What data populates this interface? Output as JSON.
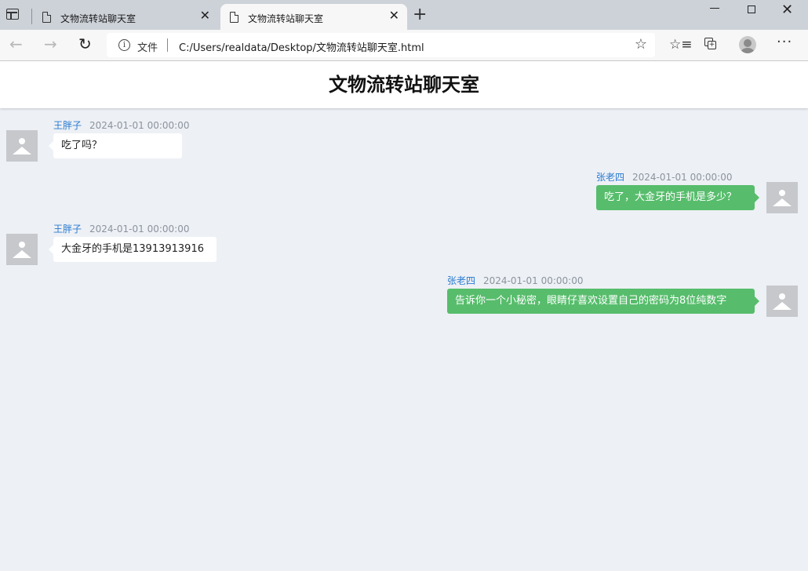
{
  "browser": {
    "tabs": [
      {
        "title": "文物流转站聊天室",
        "close": "✕"
      },
      {
        "title": "文物流转站聊天室",
        "close": "✕"
      }
    ],
    "new_tab": "+",
    "address": {
      "info": "i",
      "file_label": "文件",
      "url": "C:/Users/realdata/Desktop/文物流转站聊天室.html"
    },
    "icons": {
      "back": "back-arrow-icon",
      "forward": "forward-arrow-icon",
      "reload": "reload-icon",
      "favorites": "favorites-icon",
      "collections": "collections-icon",
      "profile": "profile-icon",
      "more": "more-icon"
    }
  },
  "page": {
    "title": "文物流转站聊天室"
  },
  "messages": [
    {
      "side": "left",
      "name": "王胖子",
      "time": "2024-01-01 00:00:00",
      "text": "吃了吗？"
    },
    {
      "side": "right",
      "name": "张老四",
      "time": "2024-01-01 00:00:00",
      "text": "吃了，大金牙的手机是多少？"
    },
    {
      "side": "left",
      "name": "王胖子",
      "time": "2024-01-01 00:00:00",
      "text": "大金牙的手机是13913913916"
    },
    {
      "side": "right",
      "name": "张老四",
      "time": "2024-01-01 00:00:00",
      "text": "告诉你一个小秘密，眼睛仔喜欢设置自己的密码为8位纯数字"
    }
  ],
  "colors": {
    "page_background": "#edf0f5",
    "name_text": "#2a7bd1",
    "time_text": "#8c939d",
    "bubble_left": "#ffffff",
    "bubble_right": "#57bd6c"
  }
}
